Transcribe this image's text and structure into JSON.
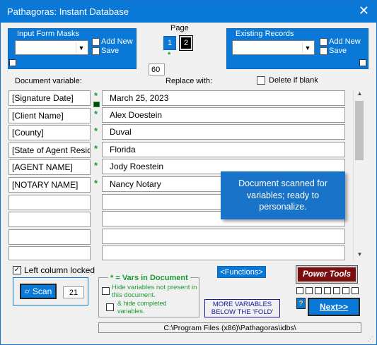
{
  "window": {
    "title": "Pathagoras: Instant Database",
    "close_glyph": "✕"
  },
  "input_form_masks": {
    "title": "Input Form Masks",
    "add_new_label": "Add New",
    "save_label": "Save"
  },
  "page": {
    "label": "Page",
    "pages": [
      "1",
      "2"
    ],
    "current": "1",
    "star": "*",
    "count_value": "60"
  },
  "existing_records": {
    "title": "Existing Records",
    "add_new_label": "Add New",
    "save_label": "Save"
  },
  "columns": {
    "document_variable": "Document variable:",
    "replace_with": "Replace with:",
    "delete_if_blank": "Delete if blank"
  },
  "rows": [
    {
      "variable": "[Signature Date]",
      "marker": "*",
      "replacement": "March 25, 2023"
    },
    {
      "variable": "[Client Name]",
      "marker": "*",
      "replacement": "Alex Doestein"
    },
    {
      "variable": "[County]",
      "marker": "*",
      "replacement": "Duval"
    },
    {
      "variable": "[State of Agent Residence]",
      "marker": "*",
      "replacement": "Florida"
    },
    {
      "variable": "[AGENT NAME]",
      "marker": "*",
      "replacement": "Jody Roestein"
    },
    {
      "variable": "[NOTARY NAME]",
      "marker": "*",
      "replacement": "Nancy Notary"
    },
    {
      "variable": "",
      "marker": "",
      "replacement": ""
    },
    {
      "variable": "",
      "marker": "",
      "replacement": ""
    },
    {
      "variable": "",
      "marker": "",
      "replacement": ""
    },
    {
      "variable": "",
      "marker": "",
      "replacement": ""
    }
  ],
  "tooltip": {
    "text": "Document scanned for variables; ready to personalize."
  },
  "bottom": {
    "left_column_locked": "Left column locked",
    "scan_label": "Scan",
    "scan_count": "21",
    "vars_title": "* = Vars in Document",
    "hide_not_present": "Hide variables not present in this document.",
    "hide_completed": "& hide completed variables.",
    "functions_label": "<Functions>",
    "more_variables": "MORE VARIABLES BELOW THE 'FOLD'",
    "power_tools_label": "Power Tools",
    "next_label": "Next>>",
    "path": "C:\\Program Files (x86)\\Pathagoras\\idbs\\"
  },
  "colors": {
    "accent": "#0a78d7",
    "green": "#1d9b35",
    "power_tools": "#7a0d0d"
  }
}
